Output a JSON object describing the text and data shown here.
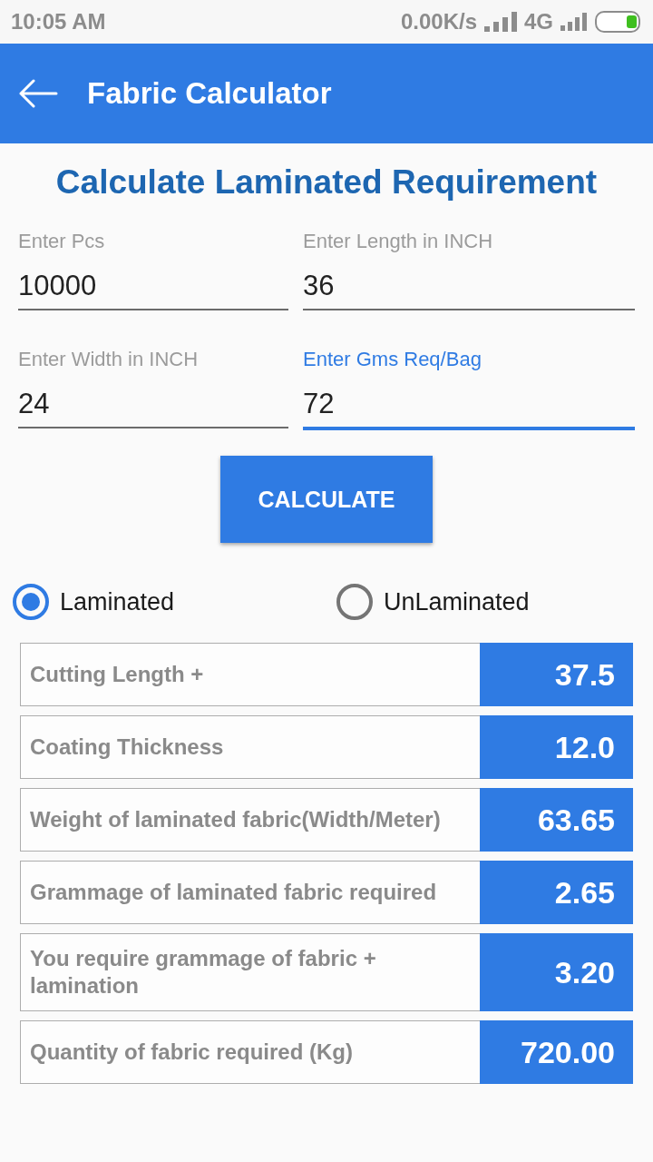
{
  "status_bar": {
    "time": "10:05 AM",
    "network_speed": "0.00K/s",
    "network_type": "4G"
  },
  "app_bar": {
    "title": "Fabric Calculator"
  },
  "heading": "Calculate Laminated Requirement",
  "fields": [
    {
      "label": "Enter Pcs",
      "value": "10000",
      "focused": false
    },
    {
      "label": "Enter Length in INCH",
      "value": "36",
      "focused": false
    },
    {
      "label": "Enter Width in INCH",
      "value": "24",
      "focused": false
    },
    {
      "label": "Enter Gms Req/Bag",
      "value": "72",
      "focused": true
    }
  ],
  "calculate_button": "CALCULATE",
  "fabric_type": [
    {
      "label": "Laminated",
      "selected": true
    },
    {
      "label": "UnLaminated",
      "selected": false
    }
  ],
  "results": [
    {
      "label": "Cutting Length +",
      "value": "37.5"
    },
    {
      "label": "Coating Thickness",
      "value": "12.0"
    },
    {
      "label": "Weight of laminated fabric(Width/Meter)",
      "value": "63.65"
    },
    {
      "label": "Grammage of laminated fabric required",
      "value": "2.65"
    },
    {
      "label": "You require grammage of fabric + lamination",
      "value": "3.20"
    },
    {
      "label": "Quantity of fabric required (Kg)",
      "value": "720.00"
    }
  ]
}
